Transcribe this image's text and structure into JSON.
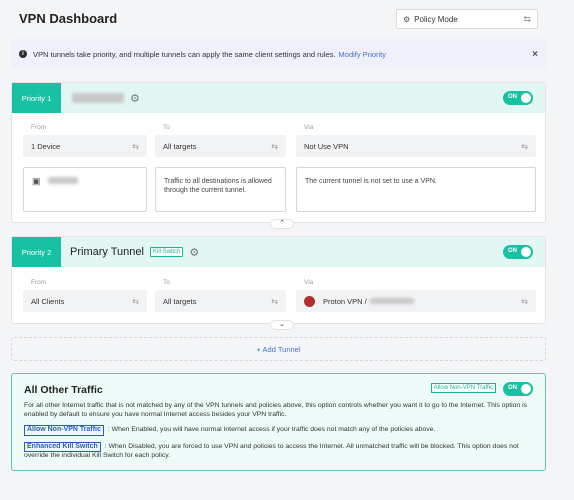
{
  "header": {
    "title": "VPN Dashboard"
  },
  "policy_mode": {
    "label": "Policy Mode",
    "icon": "network-icon"
  },
  "notice": {
    "text": "VPN tunnels take priority, and multiple tunnels can apply the same client settings and rules.",
    "link": "Modify Priority"
  },
  "tunnel1": {
    "priority": "Priority 1",
    "toggle": "ON",
    "from_label": "From",
    "to_label": "To",
    "via_label": "Via",
    "from_value": "1 Device",
    "to_value": "All targets",
    "via_value": "Not Use VPN",
    "to_desc": "Traffic to all destinations is allowed through the current tunnel.",
    "via_desc": "The current tunnel is not set to use a VPN."
  },
  "tunnel2": {
    "priority": "Priority 2",
    "name": "Primary Tunnel",
    "kill_switch": "Kill Switch",
    "toggle": "ON",
    "from_label": "From",
    "to_label": "To",
    "via_label": "Via",
    "from_value": "All Clients",
    "to_value": "All targets",
    "via_value": "Proton VPN /"
  },
  "add_tunnel": "+ Add Tunnel",
  "other": {
    "title": "All Other Traffic",
    "allow_btn": "Allow Non-VPN Traffic",
    "toggle": "ON",
    "desc": "For all other Internet traffic that is not matched by any of the VPN tunnels and policies above, this option controls whether you want it to go to the Internet. This option is enabled by default to ensure you have normal Internet access besides your VPN traffic.",
    "allow_label": "Allow Non-VPN Traffic",
    "allow_desc": ": When Enabled, you will have normal Internet access if your traffic does not match any of the policies above.",
    "eks_label": "Enhanced Kill Switch",
    "eks_desc": ": When Disabled, you are forced to use VPN and policies to access the Internet. All unmatched traffic will be blocked. This option does not override the individual Kill Switch for each policy."
  }
}
